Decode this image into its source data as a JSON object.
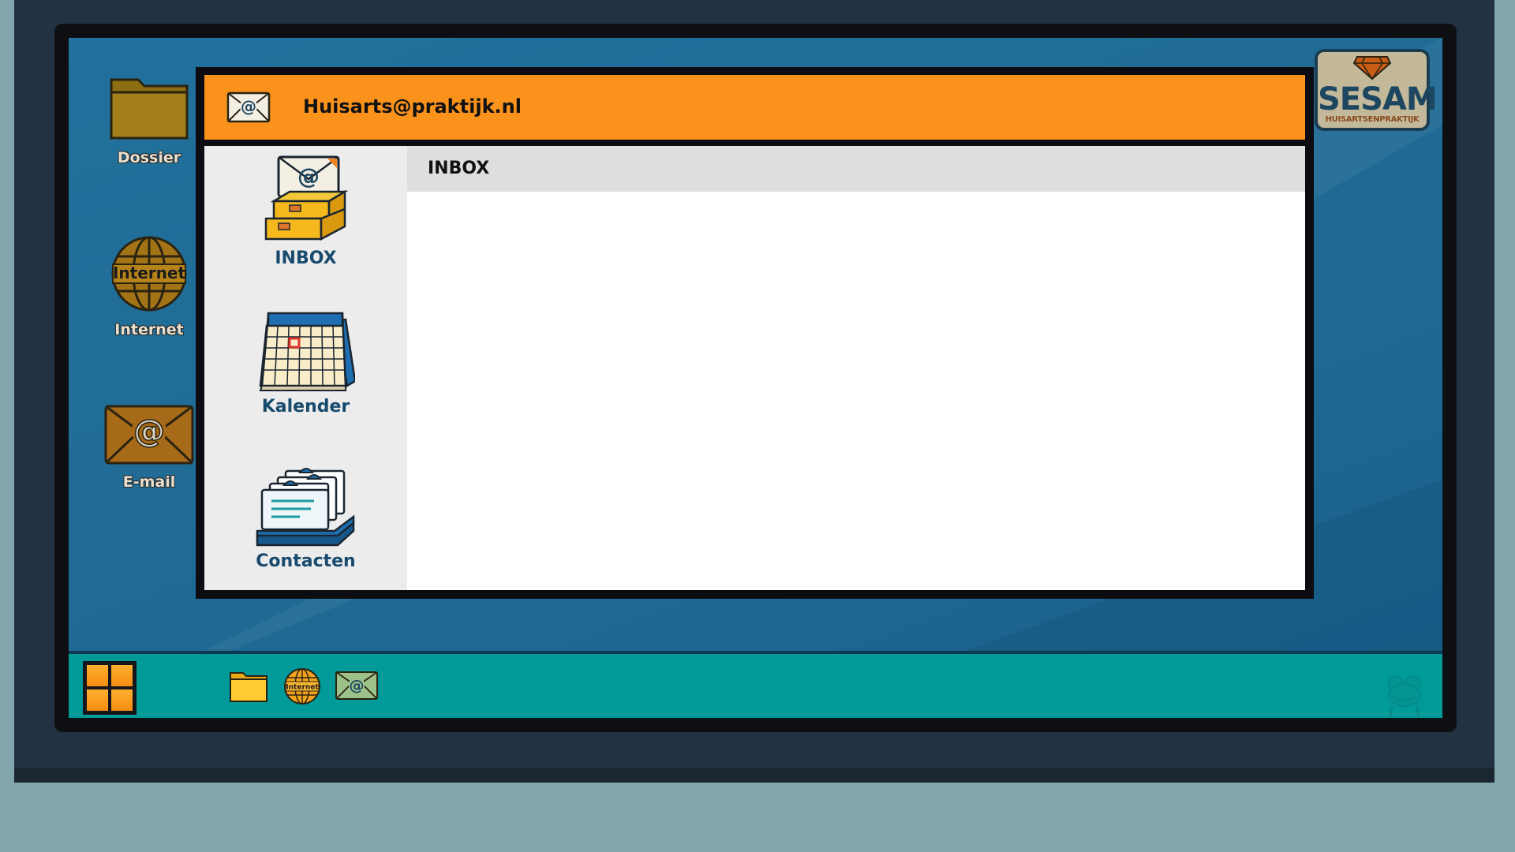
{
  "desktop": {
    "icons": [
      {
        "label": "Dossier"
      },
      {
        "label": "Internet",
        "globe_text": "Internet"
      },
      {
        "label": "E-mail"
      }
    ]
  },
  "logo": {
    "main": "SESAM",
    "sub": "HUISARTSENPRAKTIJK"
  },
  "mail_window": {
    "title": "Huisarts@praktijk.nl",
    "sidebar": [
      {
        "label": "INBOX"
      },
      {
        "label": "Kalender"
      },
      {
        "label": "Contacten"
      }
    ],
    "content_title": "INBOX"
  },
  "taskbar": {
    "internet_icon_text": "Internet"
  },
  "colors": {
    "title_bar": "#fa921c",
    "taskbar": "#009a98",
    "desktop": "#21719c",
    "sidebar_label": "#174a6c"
  }
}
